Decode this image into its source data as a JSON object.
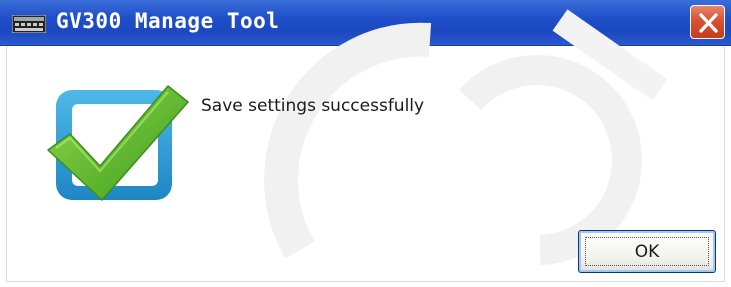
{
  "window": {
    "title": "GV300 Manage Tool",
    "message": "Save settings successfully",
    "ok_label": "OK"
  },
  "icons": {
    "app": "app-window-icon",
    "close": "close-icon",
    "status": "checkmark-icon"
  },
  "colors": {
    "titlebar": "#1f4fc9",
    "close_button": "#d75232",
    "check_green": "#5cb82a",
    "box_blue": "#2a9fd8"
  }
}
